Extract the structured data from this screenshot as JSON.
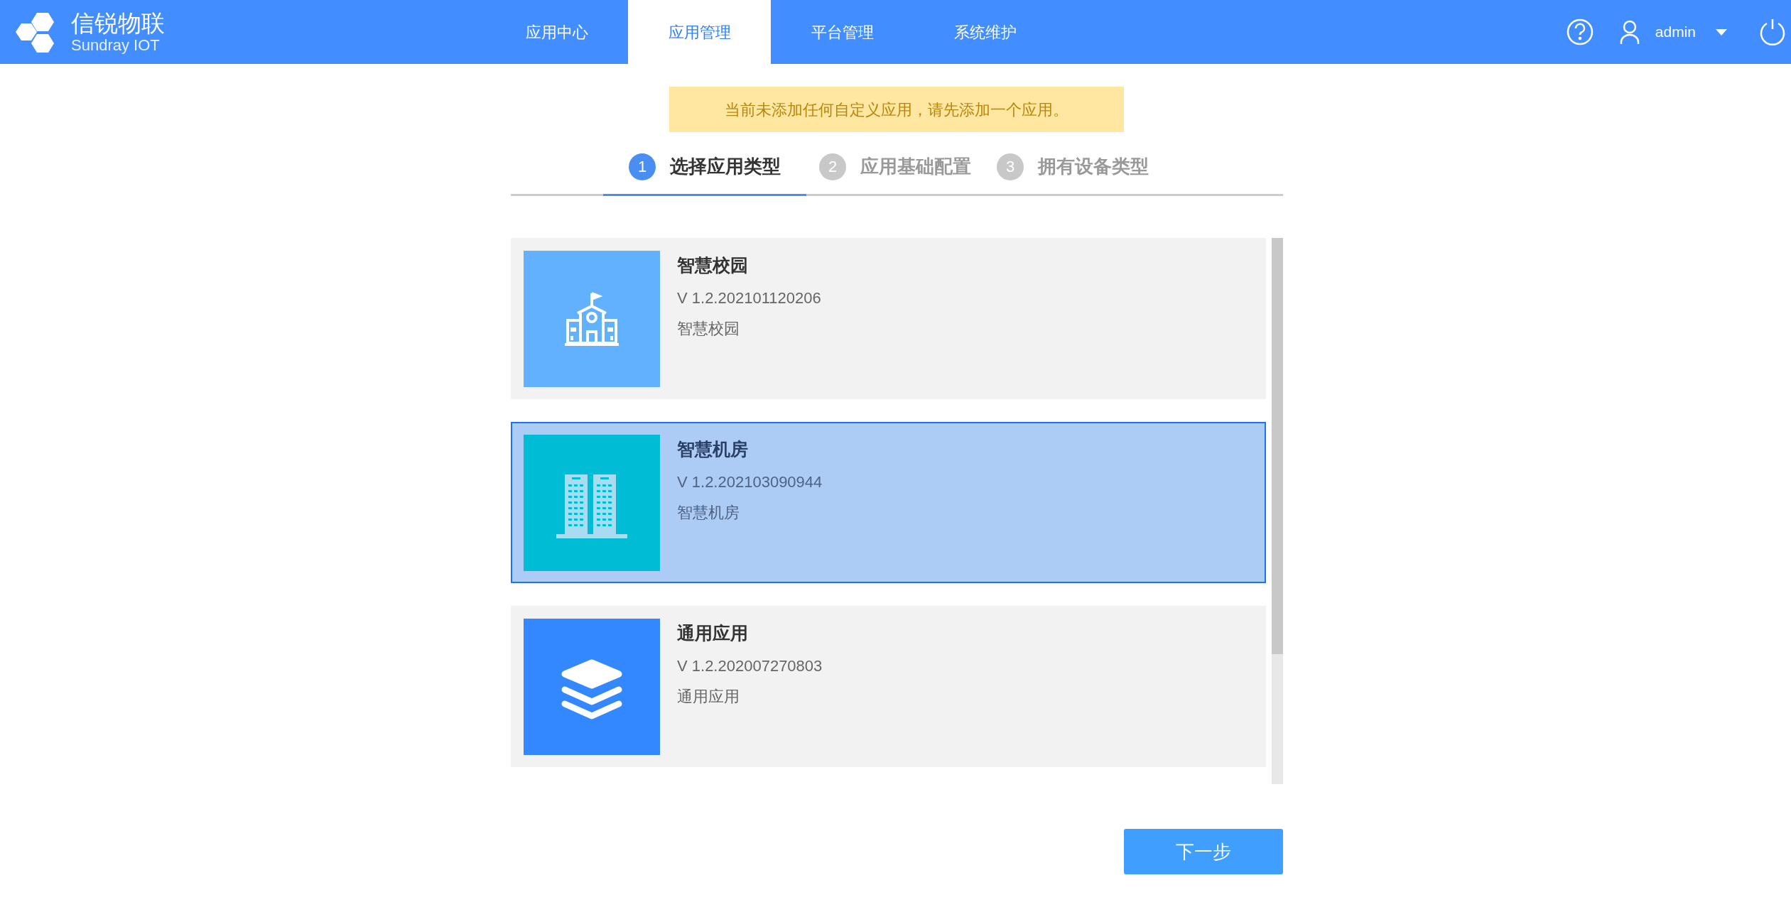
{
  "header": {
    "logo": {
      "name": "信锐物联",
      "subtitle": "Sundray IOT"
    },
    "nav": [
      {
        "label": "应用中心",
        "selected": false
      },
      {
        "label": "应用管理",
        "selected": true
      },
      {
        "label": "平台管理",
        "selected": false
      },
      {
        "label": "系统维护",
        "selected": false
      }
    ],
    "user": "admin"
  },
  "alert": "当前未添加任何自定义应用，请先添加一个应用。",
  "steps": [
    {
      "number": "1",
      "label": "选择应用类型",
      "selected": true
    },
    {
      "number": "2",
      "label": "应用基础配置",
      "selected": false
    },
    {
      "number": "3",
      "label": "拥有设备类型",
      "selected": false
    }
  ],
  "apps": [
    {
      "kind": "campus",
      "color": "#61b1ff",
      "name": "智慧校园",
      "version": "V 1.2.202101120206",
      "description": "智慧校园",
      "selected": false
    },
    {
      "kind": "buildings",
      "color": "#00bcd4",
      "name": "智慧机房",
      "version": "V 1.2.202103090944",
      "description": "智慧机房",
      "selected": true
    },
    {
      "kind": "layers",
      "color": "#3388ff",
      "name": "通用应用",
      "version": "V 1.2.202007270803",
      "description": "通用应用",
      "selected": false
    }
  ],
  "next_button": "下一步"
}
